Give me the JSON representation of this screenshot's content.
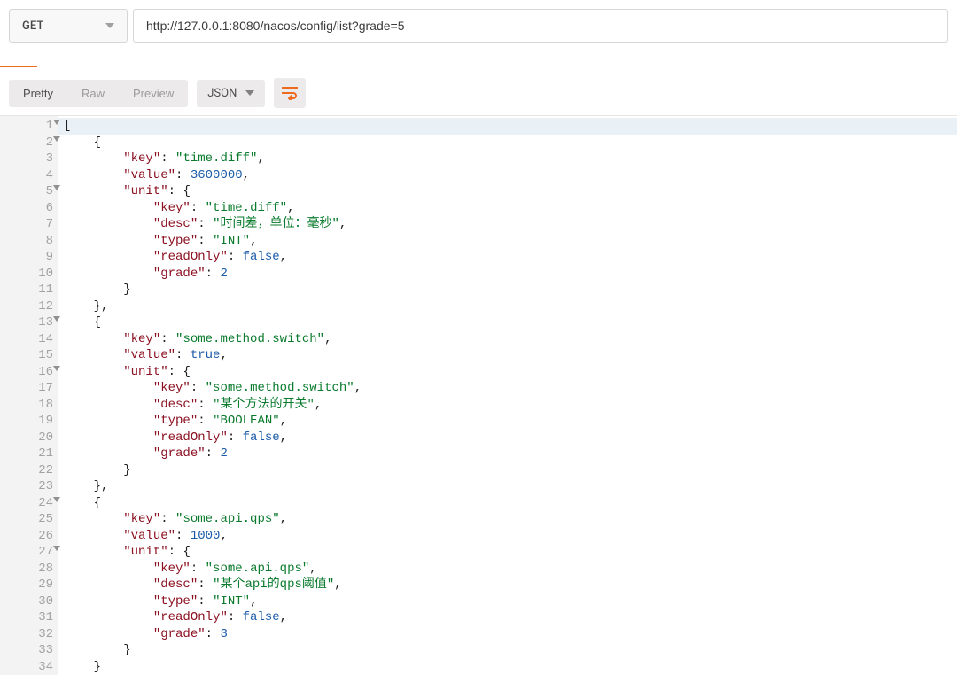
{
  "request": {
    "method": "GET",
    "url": "http://127.0.0.1:8080/nacos/config/list?grade=5"
  },
  "viewbar": {
    "tabs": {
      "pretty": "Pretty",
      "raw": "Raw",
      "preview": "Preview"
    },
    "format": "JSON"
  },
  "lines": [
    {
      "n": 1,
      "fold": true,
      "first": true,
      "indent": 0,
      "tokens": [
        {
          "t": "[",
          "c": "bracket"
        }
      ]
    },
    {
      "n": 2,
      "fold": true,
      "indent": 1,
      "tokens": [
        {
          "t": "{",
          "c": "brace"
        }
      ]
    },
    {
      "n": 3,
      "indent": 2,
      "tokens": [
        {
          "t": "\"key\"",
          "c": "keyq"
        },
        {
          "t": ":",
          "c": "colon"
        },
        {
          "t": " "
        },
        {
          "t": "\"time.diff\"",
          "c": "str"
        },
        {
          "t": ",",
          "c": "pun"
        }
      ]
    },
    {
      "n": 4,
      "indent": 2,
      "tokens": [
        {
          "t": "\"value\"",
          "c": "keyq"
        },
        {
          "t": ":",
          "c": "colon"
        },
        {
          "t": " "
        },
        {
          "t": "3600000",
          "c": "num"
        },
        {
          "t": ",",
          "c": "pun"
        }
      ]
    },
    {
      "n": 5,
      "fold": true,
      "indent": 2,
      "tokens": [
        {
          "t": "\"unit\"",
          "c": "keyq"
        },
        {
          "t": ":",
          "c": "colon"
        },
        {
          "t": " "
        },
        {
          "t": "{",
          "c": "brace"
        }
      ]
    },
    {
      "n": 6,
      "indent": 3,
      "tokens": [
        {
          "t": "\"key\"",
          "c": "keyq"
        },
        {
          "t": ":",
          "c": "colon"
        },
        {
          "t": " "
        },
        {
          "t": "\"time.diff\"",
          "c": "str"
        },
        {
          "t": ",",
          "c": "pun"
        }
      ]
    },
    {
      "n": 7,
      "indent": 3,
      "tokens": [
        {
          "t": "\"desc\"",
          "c": "keyq"
        },
        {
          "t": ":",
          "c": "colon"
        },
        {
          "t": " "
        },
        {
          "t": "\"时间差，单位：毫秒\"",
          "c": "str"
        },
        {
          "t": ",",
          "c": "pun"
        }
      ]
    },
    {
      "n": 8,
      "indent": 3,
      "tokens": [
        {
          "t": "\"type\"",
          "c": "keyq"
        },
        {
          "t": ":",
          "c": "colon"
        },
        {
          "t": " "
        },
        {
          "t": "\"INT\"",
          "c": "str"
        },
        {
          "t": ",",
          "c": "pun"
        }
      ]
    },
    {
      "n": 9,
      "indent": 3,
      "tokens": [
        {
          "t": "\"readOnly\"",
          "c": "keyq"
        },
        {
          "t": ":",
          "c": "colon"
        },
        {
          "t": " "
        },
        {
          "t": "false",
          "c": "boo"
        },
        {
          "t": ",",
          "c": "pun"
        }
      ]
    },
    {
      "n": 10,
      "indent": 3,
      "tokens": [
        {
          "t": "\"grade\"",
          "c": "keyq"
        },
        {
          "t": ":",
          "c": "colon"
        },
        {
          "t": " "
        },
        {
          "t": "2",
          "c": "num"
        }
      ]
    },
    {
      "n": 11,
      "indent": 2,
      "tokens": [
        {
          "t": "}",
          "c": "brace"
        }
      ]
    },
    {
      "n": 12,
      "indent": 1,
      "tokens": [
        {
          "t": "}",
          "c": "brace"
        },
        {
          "t": ",",
          "c": "pun"
        }
      ]
    },
    {
      "n": 13,
      "fold": true,
      "indent": 1,
      "tokens": [
        {
          "t": "{",
          "c": "brace"
        }
      ]
    },
    {
      "n": 14,
      "indent": 2,
      "tokens": [
        {
          "t": "\"key\"",
          "c": "keyq"
        },
        {
          "t": ":",
          "c": "colon"
        },
        {
          "t": " "
        },
        {
          "t": "\"some.method.switch\"",
          "c": "str"
        },
        {
          "t": ",",
          "c": "pun"
        }
      ]
    },
    {
      "n": 15,
      "indent": 2,
      "tokens": [
        {
          "t": "\"value\"",
          "c": "keyq"
        },
        {
          "t": ":",
          "c": "colon"
        },
        {
          "t": " "
        },
        {
          "t": "true",
          "c": "boo"
        },
        {
          "t": ",",
          "c": "pun"
        }
      ]
    },
    {
      "n": 16,
      "fold": true,
      "indent": 2,
      "tokens": [
        {
          "t": "\"unit\"",
          "c": "keyq"
        },
        {
          "t": ":",
          "c": "colon"
        },
        {
          "t": " "
        },
        {
          "t": "{",
          "c": "brace"
        }
      ]
    },
    {
      "n": 17,
      "indent": 3,
      "tokens": [
        {
          "t": "\"key\"",
          "c": "keyq"
        },
        {
          "t": ":",
          "c": "colon"
        },
        {
          "t": " "
        },
        {
          "t": "\"some.method.switch\"",
          "c": "str"
        },
        {
          "t": ",",
          "c": "pun"
        }
      ]
    },
    {
      "n": 18,
      "indent": 3,
      "tokens": [
        {
          "t": "\"desc\"",
          "c": "keyq"
        },
        {
          "t": ":",
          "c": "colon"
        },
        {
          "t": " "
        },
        {
          "t": "\"某个方法的开关\"",
          "c": "str"
        },
        {
          "t": ",",
          "c": "pun"
        }
      ]
    },
    {
      "n": 19,
      "indent": 3,
      "tokens": [
        {
          "t": "\"type\"",
          "c": "keyq"
        },
        {
          "t": ":",
          "c": "colon"
        },
        {
          "t": " "
        },
        {
          "t": "\"BOOLEAN\"",
          "c": "str"
        },
        {
          "t": ",",
          "c": "pun"
        }
      ]
    },
    {
      "n": 20,
      "indent": 3,
      "tokens": [
        {
          "t": "\"readOnly\"",
          "c": "keyq"
        },
        {
          "t": ":",
          "c": "colon"
        },
        {
          "t": " "
        },
        {
          "t": "false",
          "c": "boo"
        },
        {
          "t": ",",
          "c": "pun"
        }
      ]
    },
    {
      "n": 21,
      "indent": 3,
      "tokens": [
        {
          "t": "\"grade\"",
          "c": "keyq"
        },
        {
          "t": ":",
          "c": "colon"
        },
        {
          "t": " "
        },
        {
          "t": "2",
          "c": "num"
        }
      ]
    },
    {
      "n": 22,
      "indent": 2,
      "tokens": [
        {
          "t": "}",
          "c": "brace"
        }
      ]
    },
    {
      "n": 23,
      "indent": 1,
      "tokens": [
        {
          "t": "}",
          "c": "brace"
        },
        {
          "t": ",",
          "c": "pun"
        }
      ]
    },
    {
      "n": 24,
      "fold": true,
      "indent": 1,
      "tokens": [
        {
          "t": "{",
          "c": "brace"
        }
      ]
    },
    {
      "n": 25,
      "indent": 2,
      "tokens": [
        {
          "t": "\"key\"",
          "c": "keyq"
        },
        {
          "t": ":",
          "c": "colon"
        },
        {
          "t": " "
        },
        {
          "t": "\"some.api.qps\"",
          "c": "str"
        },
        {
          "t": ",",
          "c": "pun"
        }
      ]
    },
    {
      "n": 26,
      "indent": 2,
      "tokens": [
        {
          "t": "\"value\"",
          "c": "keyq"
        },
        {
          "t": ":",
          "c": "colon"
        },
        {
          "t": " "
        },
        {
          "t": "1000",
          "c": "num"
        },
        {
          "t": ",",
          "c": "pun"
        }
      ]
    },
    {
      "n": 27,
      "fold": true,
      "indent": 2,
      "tokens": [
        {
          "t": "\"unit\"",
          "c": "keyq"
        },
        {
          "t": ":",
          "c": "colon"
        },
        {
          "t": " "
        },
        {
          "t": "{",
          "c": "brace"
        }
      ]
    },
    {
      "n": 28,
      "indent": 3,
      "tokens": [
        {
          "t": "\"key\"",
          "c": "keyq"
        },
        {
          "t": ":",
          "c": "colon"
        },
        {
          "t": " "
        },
        {
          "t": "\"some.api.qps\"",
          "c": "str"
        },
        {
          "t": ",",
          "c": "pun"
        }
      ]
    },
    {
      "n": 29,
      "indent": 3,
      "tokens": [
        {
          "t": "\"desc\"",
          "c": "keyq"
        },
        {
          "t": ":",
          "c": "colon"
        },
        {
          "t": " "
        },
        {
          "t": "\"某个api的qps阈值\"",
          "c": "str"
        },
        {
          "t": ",",
          "c": "pun"
        }
      ]
    },
    {
      "n": 30,
      "indent": 3,
      "tokens": [
        {
          "t": "\"type\"",
          "c": "keyq"
        },
        {
          "t": ":",
          "c": "colon"
        },
        {
          "t": " "
        },
        {
          "t": "\"INT\"",
          "c": "str"
        },
        {
          "t": ",",
          "c": "pun"
        }
      ]
    },
    {
      "n": 31,
      "indent": 3,
      "tokens": [
        {
          "t": "\"readOnly\"",
          "c": "keyq"
        },
        {
          "t": ":",
          "c": "colon"
        },
        {
          "t": " "
        },
        {
          "t": "false",
          "c": "boo"
        },
        {
          "t": ",",
          "c": "pun"
        }
      ]
    },
    {
      "n": 32,
      "indent": 3,
      "tokens": [
        {
          "t": "\"grade\"",
          "c": "keyq"
        },
        {
          "t": ":",
          "c": "colon"
        },
        {
          "t": " "
        },
        {
          "t": "3",
          "c": "num"
        }
      ]
    },
    {
      "n": 33,
      "indent": 2,
      "tokens": [
        {
          "t": "}",
          "c": "brace"
        }
      ]
    },
    {
      "n": 34,
      "indent": 1,
      "tokens": [
        {
          "t": "}",
          "c": "brace"
        }
      ]
    }
  ],
  "indent_unit": "    "
}
